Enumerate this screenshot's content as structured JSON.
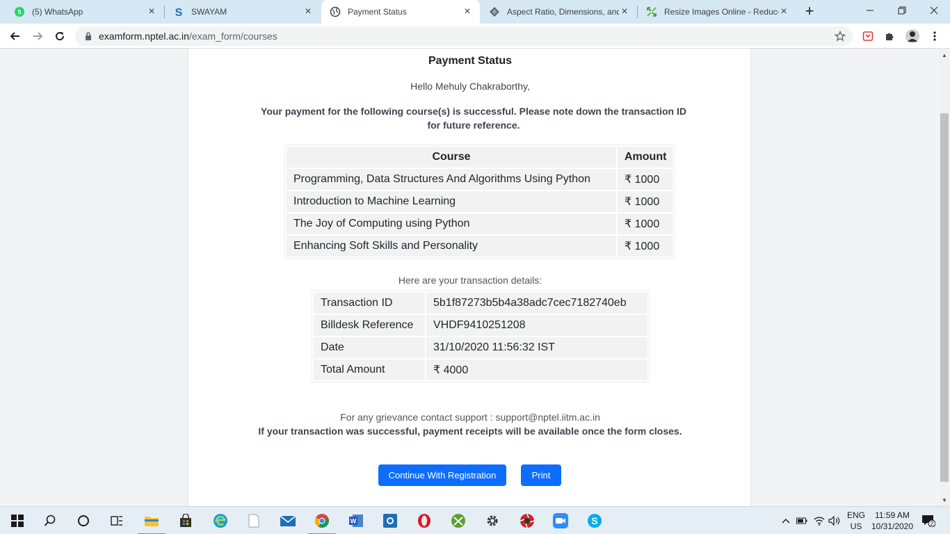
{
  "browser": {
    "tabs": [
      {
        "title": "(5) WhatsApp",
        "icon": "whatsapp-icon"
      },
      {
        "title": "SWAYAM",
        "icon": "swayam-icon"
      },
      {
        "title": "Payment Status",
        "icon": "globe-icon"
      },
      {
        "title": "Aspect Ratio, Dimensions, and",
        "icon": "diamond-icon"
      },
      {
        "title": "Resize Images Online - Reduce",
        "icon": "resize-icon"
      }
    ],
    "url_host": "examform.nptel.ac.in",
    "url_path": "/exam_form/courses"
  },
  "page": {
    "title": "Payment Status",
    "greeting": "Hello Mehuly Chakraborthy,",
    "note": "Your payment for the following course(s) is successful. Please note down the transaction ID for future reference.",
    "courses_header": {
      "course": "Course",
      "amount": "Amount"
    },
    "courses": [
      {
        "course": "Programming, Data Structures And Algorithms Using Python",
        "amount": "₹ 1000"
      },
      {
        "course": "Introduction to Machine Learning",
        "amount": "₹ 1000"
      },
      {
        "course": "The Joy of Computing using Python",
        "amount": "₹ 1000"
      },
      {
        "course": "Enhancing Soft Skills and Personality",
        "amount": "₹ 1000"
      }
    ],
    "details_label": "Here are your transaction details:",
    "transaction": [
      {
        "label": "Transaction ID",
        "value": "5b1f87273b5b4a38adc7cec7182740eb"
      },
      {
        "label": "Billdesk Reference",
        "value": "VHDF9410251208"
      },
      {
        "label": "Date",
        "value": "31/10/2020 11:56:32 IST"
      },
      {
        "label": "Total Amount",
        "value": "₹ 4000"
      }
    ],
    "grievance": "For any grievance contact support : support@nptel.iitm.ac.in",
    "receipts_note": "If your transaction was successful, payment receipts will be available once the form closes.",
    "continue_label": "Continue With Registration",
    "print_label": "Print"
  },
  "taskbar": {
    "lang_line1": "ENG",
    "lang_line2": "US",
    "time": "11:59 AM",
    "date": "10/31/2020",
    "notifications": "2"
  },
  "colors": {
    "primary_button": "#0d6efd",
    "tabstrip": "#d6e8f3"
  }
}
